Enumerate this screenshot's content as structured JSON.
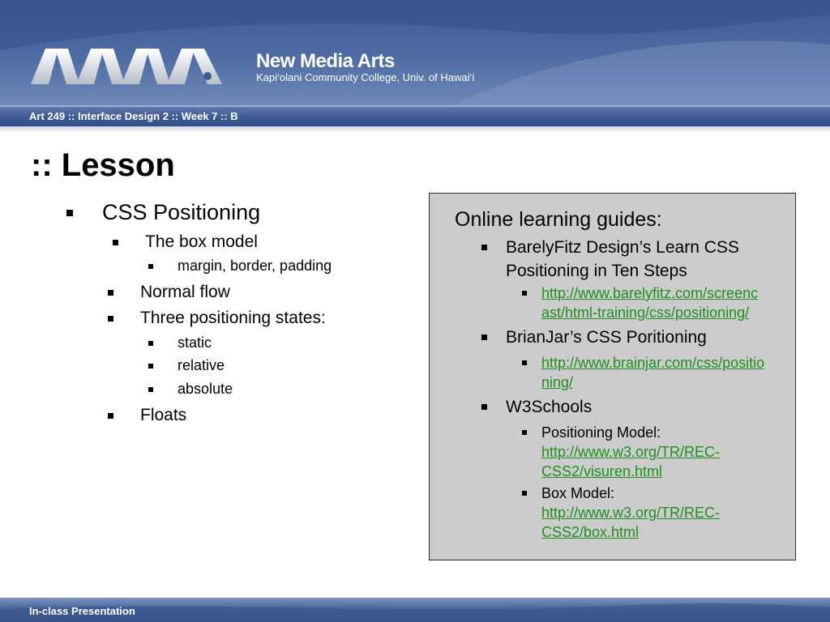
{
  "header": {
    "brand_title": "New Media Arts",
    "brand_subtitle": "Kapi‘olani Community College, Univ. of Hawai‘i",
    "course": "Art 249 :: Interface Design 2 :: Week 7 :: B"
  },
  "page_title": ":: Lesson",
  "outline": {
    "topic": "CSS Positioning",
    "box_model": "The box model",
    "box_model_parts": "margin, border, padding",
    "normal_flow": "Normal flow",
    "states_heading": "Three positioning states:",
    "states": [
      "static",
      "relative",
      "absolute"
    ],
    "floats": "Floats"
  },
  "guides": {
    "heading": "Online learning guides:",
    "barelyfitz": {
      "title_line1": "BarelyFitz Design’s Learn CSS",
      "title_line2": "Positioning in Ten Steps",
      "url_line1": "http://www.barelyfitz.com/screenc",
      "url_line2": "ast/html-training/css/positioning/"
    },
    "brainjar": {
      "title": "BrianJar’s CSS Poritioning",
      "url_line1": "http://www.brainjar.com/css/positio",
      "url_line2": "ning/"
    },
    "w3schools": {
      "title": "W3Schools",
      "positioning_label": "Positioning Model:",
      "positioning_url_line1": "http://www.w3.org/TR/REC-",
      "positioning_url_line2": "CSS2/visuren.html",
      "box_label": "Box Model:",
      "box_url_line1": "http://www.w3.org/TR/REC-",
      "box_url_line2": "CSS2/box.html"
    }
  },
  "footer": {
    "text": "In-class Presentation"
  },
  "colors": {
    "link": "#1f8f1f",
    "guides_box": "#cccccc",
    "banner": "#4f6ca4"
  }
}
